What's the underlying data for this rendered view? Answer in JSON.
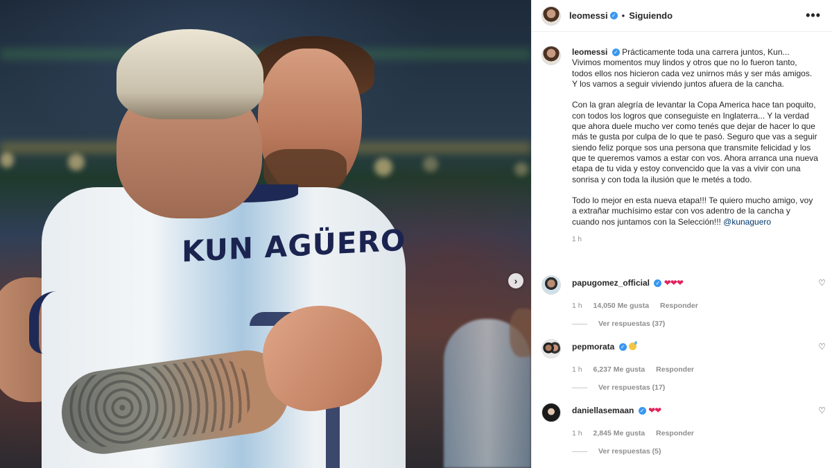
{
  "post": {
    "username": "leomessi",
    "follow_state": "Siguiendo",
    "separator": "•",
    "more_label": "•••",
    "verified_glyph": "✓",
    "caption_paragraphs": [
      "Prácticamente toda una carrera juntos, Kun... Vivimos momentos muy lindos y otros que no lo fueron tanto, todos ellos nos hicieron cada vez unirnos más y ser más amigos. Y los vamos a seguir viviendo juntos afuera de la cancha.",
      "Con la gran alegría de levantar la Copa America hace tan poquito, con todos los logros que conseguiste en Inglaterra... Y la verdad que ahora duele mucho ver como tenés que dejar de hacer lo que más te gusta por culpa de lo que te pasó. Seguro que vas a seguir siendo feliz porque sos una persona que transmite felicidad y los que te queremos vamos a estar con vos. Ahora arranca una nueva etapa de tu vida y estoy convencido que la vas a vivir con una sonrisa y con toda la ilusión que le metés a todo.",
      "Todo lo mejor en esta nueva etapa!!! Te quiero mucho amigo, voy a extrañar muchísimo estar con vos adentro de la cancha y cuando nos juntamos con la Selección!!!"
    ],
    "mention": "@kunaguero",
    "time": "1 h",
    "photo_text": "KUN AGÜERO",
    "carousel_next_icon": "›"
  },
  "comments": [
    {
      "username": "papugomez_official",
      "text": "❤❤❤",
      "time": "1 h",
      "likes": "14,050 Me gusta",
      "reply_label": "Responder",
      "replies_label": "Ver respuestas (37)"
    },
    {
      "username": "pepmorata",
      "text": "",
      "time": "1 h",
      "likes": "6,237 Me gusta",
      "reply_label": "Responder",
      "replies_label": "Ver respuestas (17)"
    },
    {
      "username": "daniellasemaan",
      "text": "❤❤",
      "time": "1 h",
      "likes": "2,845 Me gusta",
      "reply_label": "Responder",
      "replies_label": "Ver respuestas (5)"
    }
  ],
  "icons": {
    "like": "♡",
    "verified_color": "#3897f0",
    "heart_color": "#e0245e",
    "mention_color": "#00376b"
  }
}
